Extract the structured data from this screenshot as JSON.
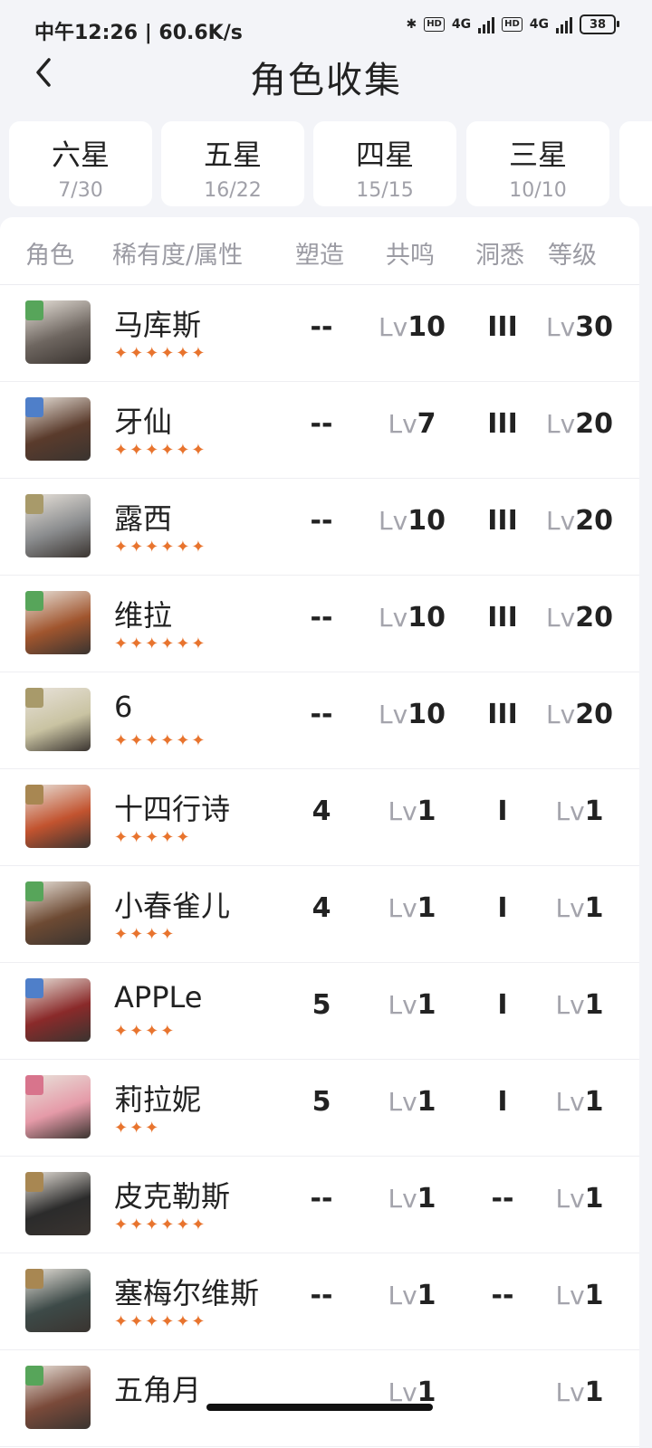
{
  "status": {
    "left": "中午12:26 | 60.6K/s",
    "net1": "4G",
    "net2": "4G",
    "hd": "HD",
    "battery": "38"
  },
  "header": {
    "title": "角色收集"
  },
  "tabs": [
    {
      "name": "六星",
      "count": "7/30"
    },
    {
      "name": "五星",
      "count": "16/22"
    },
    {
      "name": "四星",
      "count": "15/15"
    },
    {
      "name": "三星",
      "count": "10/10"
    }
  ],
  "columns": {
    "role": "角色",
    "rarity": "稀有度/属性",
    "shaping": "塑造",
    "resonance": "共鸣",
    "insight": "洞悉",
    "level": "等级"
  },
  "lv_prefix": "Lv",
  "rows": [
    {
      "name": "马库斯",
      "stars": "✦✦✦✦✦✦",
      "shaping": "--",
      "resonance": "10",
      "insight": "III",
      "level": "30",
      "elem_color": "#57a55a",
      "avatar_color": "#6e6660"
    },
    {
      "name": "牙仙",
      "stars": "✦✦✦✦✦✦",
      "shaping": "--",
      "resonance": "7",
      "insight": "III",
      "level": "20",
      "elem_color": "#4f7fc9",
      "avatar_color": "#5a3b2c"
    },
    {
      "name": "露西",
      "stars": "✦✦✦✦✦✦",
      "shaping": "--",
      "resonance": "10",
      "insight": "III",
      "level": "20",
      "elem_color": "#a89a6a",
      "avatar_color": "#8a8c8e"
    },
    {
      "name": "维拉",
      "stars": "✦✦✦✦✦✦",
      "shaping": "--",
      "resonance": "10",
      "insight": "III",
      "level": "20",
      "elem_color": "#57a55a",
      "avatar_color": "#a0552e"
    },
    {
      "name": "6",
      "stars": "✦✦✦✦✦✦",
      "shaping": "--",
      "resonance": "10",
      "insight": "III",
      "level": "20",
      "elem_color": "#a89a6a",
      "avatar_color": "#c9c3a2"
    },
    {
      "name": "十四行诗",
      "stars": "✦✦✦✦✦",
      "shaping": "4",
      "resonance": "1",
      "insight": "I",
      "level": "1",
      "elem_color": "#a88752",
      "avatar_color": "#c2532f"
    },
    {
      "name": "小春雀儿",
      "stars": "✦✦✦✦",
      "shaping": "4",
      "resonance": "1",
      "insight": "I",
      "level": "1",
      "elem_color": "#57a55a",
      "avatar_color": "#6d4a33"
    },
    {
      "name": "APPLe",
      "stars": "✦✦✦✦",
      "shaping": "5",
      "resonance": "1",
      "insight": "I",
      "level": "1",
      "elem_color": "#4f7fc9",
      "avatar_color": "#8a2a2a"
    },
    {
      "name": "莉拉妮",
      "stars": "✦✦✦",
      "shaping": "5",
      "resonance": "1",
      "insight": "I",
      "level": "1",
      "elem_color": "#d8748c",
      "avatar_color": "#e59aa8"
    },
    {
      "name": "皮克勒斯",
      "stars": "✦✦✦✦✦✦",
      "shaping": "--",
      "resonance": "1",
      "insight": "--",
      "level": "1",
      "elem_color": "#a88752",
      "avatar_color": "#2b2b2b"
    },
    {
      "name": "塞梅尔维斯",
      "stars": "✦✦✦✦✦✦",
      "shaping": "--",
      "resonance": "1",
      "insight": "--",
      "level": "1",
      "elem_color": "#a88752",
      "avatar_color": "#3d4a48"
    },
    {
      "name": "五角月",
      "stars": "",
      "shaping": "",
      "resonance": "1",
      "insight": "",
      "level": "1",
      "elem_color": "#57a55a",
      "avatar_color": "#7a4a3a"
    }
  ]
}
